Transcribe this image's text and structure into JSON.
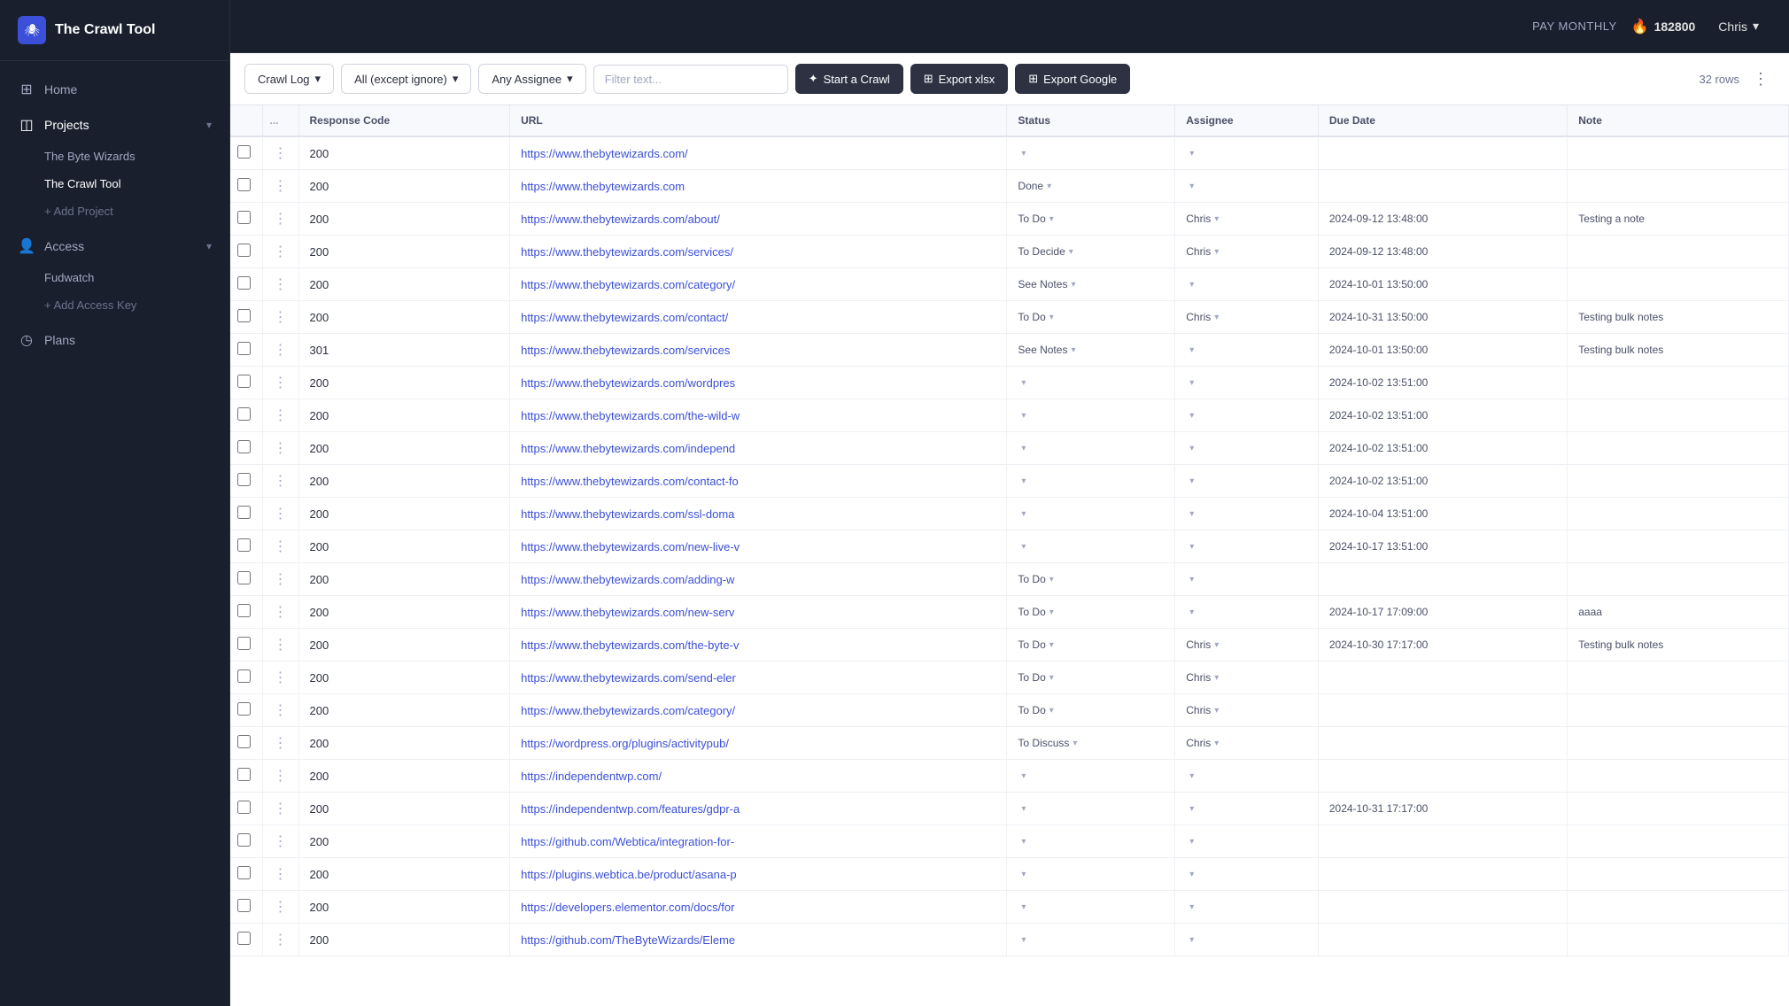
{
  "app": {
    "logo_icon": "🕷",
    "title": "The Crawl Tool"
  },
  "topbar": {
    "plan_label": "PAY MONTHLY",
    "credits_icon": "🔥",
    "credits_value": "182800",
    "user_name": "Chris",
    "chevron": "▾"
  },
  "sidebar": {
    "nav_items": [
      {
        "id": "home",
        "icon": "⊞",
        "label": "Home",
        "has_chevron": false
      },
      {
        "id": "projects",
        "icon": "◫",
        "label": "Projects",
        "has_chevron": true
      }
    ],
    "projects": [
      {
        "id": "the-byte-wizards",
        "label": "The Byte Wizards"
      },
      {
        "id": "the-crawl-tool",
        "label": "The Crawl Tool",
        "active": true
      }
    ],
    "add_project_label": "+ Add Project",
    "access_label": "Access",
    "access_items": [
      {
        "id": "fudwatch",
        "label": "Fudwatch"
      }
    ],
    "add_access_label": "+ Add Access Key",
    "plans_label": "Plans"
  },
  "toolbar": {
    "crawl_log_label": "Crawl Log",
    "filter_all_label": "All (except ignore)",
    "assignee_label": "Any Assignee",
    "filter_placeholder": "Filter text...",
    "start_crawl_label": "Start a Crawl",
    "export_xlsx_label": "Export xlsx",
    "export_google_label": "Export Google",
    "row_count": "32 rows",
    "more_icon": "⋮"
  },
  "table": {
    "columns": [
      {
        "id": "checkbox",
        "label": ""
      },
      {
        "id": "dots",
        "label": "..."
      },
      {
        "id": "response_code",
        "label": "Response Code"
      },
      {
        "id": "url",
        "label": "URL"
      },
      {
        "id": "status",
        "label": "Status"
      },
      {
        "id": "assignee",
        "label": "Assignee"
      },
      {
        "id": "due_date",
        "label": "Due Date"
      },
      {
        "id": "note",
        "label": "Note"
      }
    ],
    "rows": [
      {
        "code": "200",
        "url": "https://www.thebytewizards.com/",
        "status": "",
        "assignee": "",
        "due_date": "",
        "note": ""
      },
      {
        "code": "200",
        "url": "https://www.thebytewizards.com",
        "status": "Done",
        "assignee": "",
        "due_date": "",
        "note": ""
      },
      {
        "code": "200",
        "url": "https://www.thebytewizards.com/about/",
        "status": "To Do",
        "assignee": "Chris",
        "due_date": "2024-09-12 13:48:00",
        "note": "Testing a note"
      },
      {
        "code": "200",
        "url": "https://www.thebytewizards.com/services/",
        "status": "To Decide",
        "assignee": "Chris",
        "due_date": "2024-09-12 13:48:00",
        "note": ""
      },
      {
        "code": "200",
        "url": "https://www.thebytewizards.com/category/",
        "status": "See Notes",
        "assignee": "",
        "due_date": "2024-10-01 13:50:00",
        "note": ""
      },
      {
        "code": "200",
        "url": "https://www.thebytewizards.com/contact/",
        "status": "To Do",
        "assignee": "Chris",
        "due_date": "2024-10-31 13:50:00",
        "note": "Testing bulk notes"
      },
      {
        "code": "301",
        "url": "https://www.thebytewizards.com/services",
        "status": "See Notes",
        "assignee": "",
        "due_date": "2024-10-01 13:50:00",
        "note": "Testing bulk notes"
      },
      {
        "code": "200",
        "url": "https://www.thebytewizards.com/wordpres",
        "status": "",
        "assignee": "",
        "due_date": "2024-10-02 13:51:00",
        "note": ""
      },
      {
        "code": "200",
        "url": "https://www.thebytewizards.com/the-wild-w",
        "status": "",
        "assignee": "",
        "due_date": "2024-10-02 13:51:00",
        "note": ""
      },
      {
        "code": "200",
        "url": "https://www.thebytewizards.com/independ",
        "status": "",
        "assignee": "",
        "due_date": "2024-10-02 13:51:00",
        "note": ""
      },
      {
        "code": "200",
        "url": "https://www.thebytewizards.com/contact-fo",
        "status": "",
        "assignee": "",
        "due_date": "2024-10-02 13:51:00",
        "note": ""
      },
      {
        "code": "200",
        "url": "https://www.thebytewizards.com/ssl-doma",
        "status": "",
        "assignee": "",
        "due_date": "2024-10-04 13:51:00",
        "note": ""
      },
      {
        "code": "200",
        "url": "https://www.thebytewizards.com/new-live-v",
        "status": "",
        "assignee": "",
        "due_date": "2024-10-17 13:51:00",
        "note": ""
      },
      {
        "code": "200",
        "url": "https://www.thebytewizards.com/adding-w",
        "status": "To Do",
        "assignee": "",
        "due_date": "",
        "note": ""
      },
      {
        "code": "200",
        "url": "https://www.thebytewizards.com/new-serv",
        "status": "To Do",
        "assignee": "",
        "due_date": "2024-10-17 17:09:00",
        "note": "aaaa"
      },
      {
        "code": "200",
        "url": "https://www.thebytewizards.com/the-byte-v",
        "status": "To Do",
        "assignee": "Chris",
        "due_date": "2024-10-30 17:17:00",
        "note": "Testing bulk notes"
      },
      {
        "code": "200",
        "url": "https://www.thebytewizards.com/send-eler",
        "status": "To Do",
        "assignee": "Chris",
        "due_date": "",
        "note": ""
      },
      {
        "code": "200",
        "url": "https://www.thebytewizards.com/category/",
        "status": "To Do",
        "assignee": "Chris",
        "due_date": "",
        "note": ""
      },
      {
        "code": "200",
        "url": "https://wordpress.org/plugins/activitypub/",
        "status": "To Discuss",
        "assignee": "Chris",
        "due_date": "",
        "note": ""
      },
      {
        "code": "200",
        "url": "https://independentwp.com/",
        "status": "",
        "assignee": "",
        "due_date": "",
        "note": ""
      },
      {
        "code": "200",
        "url": "https://independentwp.com/features/gdpr-a",
        "status": "",
        "assignee": "",
        "due_date": "2024-10-31 17:17:00",
        "note": ""
      },
      {
        "code": "200",
        "url": "https://github.com/Webtica/integration-for-",
        "status": "",
        "assignee": "",
        "due_date": "",
        "note": ""
      },
      {
        "code": "200",
        "url": "https://plugins.webtica.be/product/asana-p",
        "status": "",
        "assignee": "",
        "due_date": "",
        "note": ""
      },
      {
        "code": "200",
        "url": "https://developers.elementor.com/docs/for",
        "status": "",
        "assignee": "",
        "due_date": "",
        "note": ""
      },
      {
        "code": "200",
        "url": "https://github.com/TheByteWizards/Eleme",
        "status": "",
        "assignee": "",
        "due_date": "",
        "note": ""
      }
    ]
  }
}
